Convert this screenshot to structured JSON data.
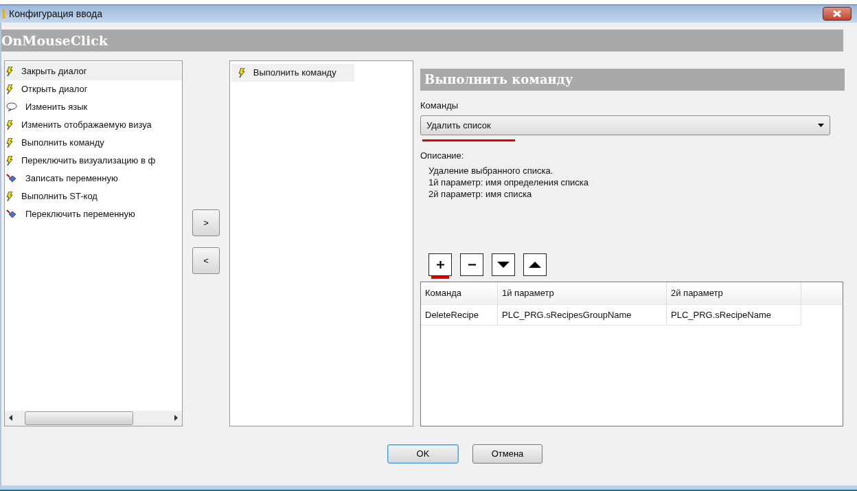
{
  "window": {
    "title": "Конфигурация ввода"
  },
  "event_header": "OnMouseClick",
  "actions": [
    {
      "label": "Закрыть диалог",
      "kind": "bolt",
      "selected": true
    },
    {
      "label": "Открыть диалог",
      "kind": "bolt",
      "selected": false
    },
    {
      "label": "Изменить язык",
      "kind": "speech",
      "selected": false
    },
    {
      "label": "Изменить отображаемую визуа",
      "kind": "bolt",
      "selected": false
    },
    {
      "label": "Выполнить команду",
      "kind": "bolt",
      "selected": false
    },
    {
      "label": "Переключить визуализацию в ф",
      "kind": "bolt",
      "selected": false
    },
    {
      "label": "Записать переменную",
      "kind": "variable",
      "selected": false
    },
    {
      "label": "Выполнить ST-код",
      "kind": "bolt",
      "selected": false
    },
    {
      "label": "Переключить переменную",
      "kind": "variable",
      "selected": false
    }
  ],
  "move_buttons": [
    ">",
    "<"
  ],
  "chosen_actions": [
    {
      "label": "Выполнить команду",
      "kind": "bolt",
      "selected": true
    }
  ],
  "detail": {
    "title": "Выполнить команду",
    "commands_label": "Команды",
    "command": {
      "value": "Удалить список",
      "underlined": true
    },
    "description_label": "Описание:",
    "description": [
      "Удаление выбранного списка.",
      "1й параметр: имя определения списка",
      "2й параметр: имя списка"
    ],
    "tools": [
      {
        "kind": "add",
        "underlined": true
      },
      {
        "kind": "remove",
        "underlined": false
      },
      {
        "kind": "down",
        "underlined": false
      },
      {
        "kind": "up",
        "underlined": false
      }
    ],
    "table": {
      "columns": [
        "Команда",
        "1й параметр",
        "2й параметр"
      ],
      "rows": [
        [
          "DeleteRecipe",
          "PLC_PRG.sRecipesGroupName",
          "PLC_PRG.sRecipeName"
        ]
      ]
    }
  },
  "buttons": [
    {
      "label": "OK",
      "default": true
    },
    {
      "label": "Отмена",
      "default": false
    }
  ]
}
